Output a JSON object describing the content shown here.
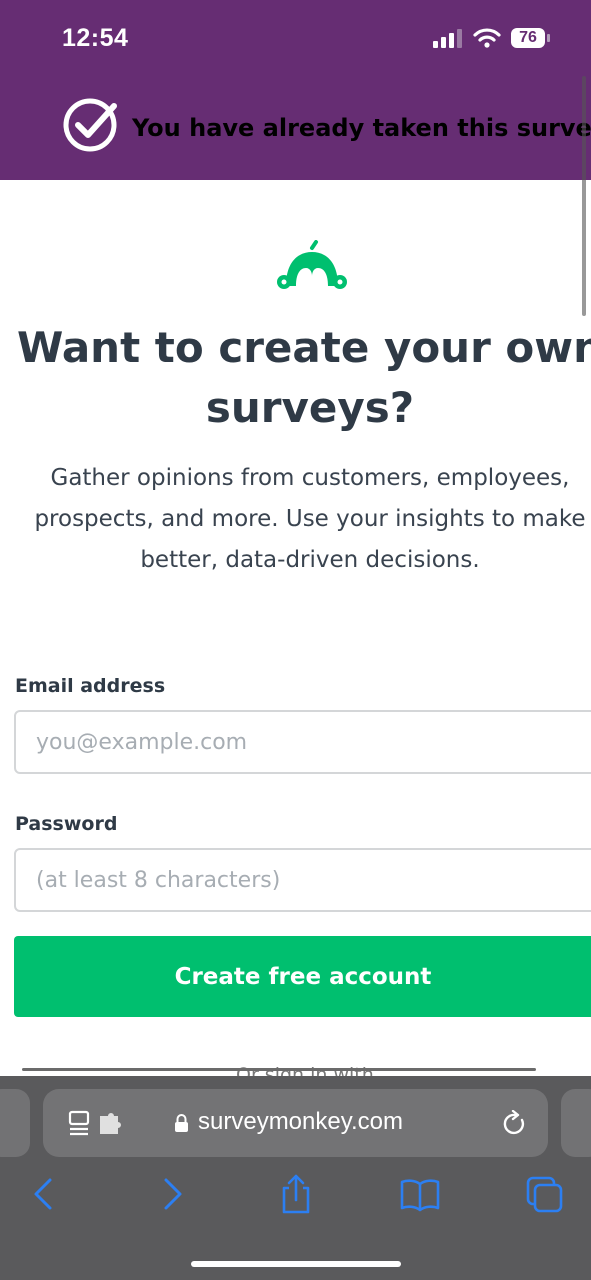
{
  "status_bar": {
    "time": "12:54",
    "battery": "76",
    "background_color": "#662d73"
  },
  "banner": {
    "text": "You have already taken this survey",
    "icon": "check-circle-icon"
  },
  "main": {
    "logo_icon": "surveymonkey-logo-icon",
    "brand_color": "#00bf6f",
    "headline_line1": "Want to create your own",
    "headline_line2": "surveys?",
    "subtext_line1": "Gather opinions from customers, employees,",
    "subtext_line2": "prospects, and more. Use your insights to make",
    "subtext_line3": "better, data-driven decisions."
  },
  "form": {
    "email_label": "Email address",
    "email_placeholder": "you@example.com",
    "email_value": "",
    "password_label": "Password",
    "password_placeholder": "(at least 8 characters)",
    "password_value": "",
    "submit_label": "Create free account",
    "divider_text": "Or sign in with"
  },
  "browser": {
    "url": "surveymonkey.com",
    "toolbar": [
      "back-icon",
      "forward-icon",
      "share-icon",
      "bookmarks-icon",
      "tabs-icon"
    ]
  }
}
